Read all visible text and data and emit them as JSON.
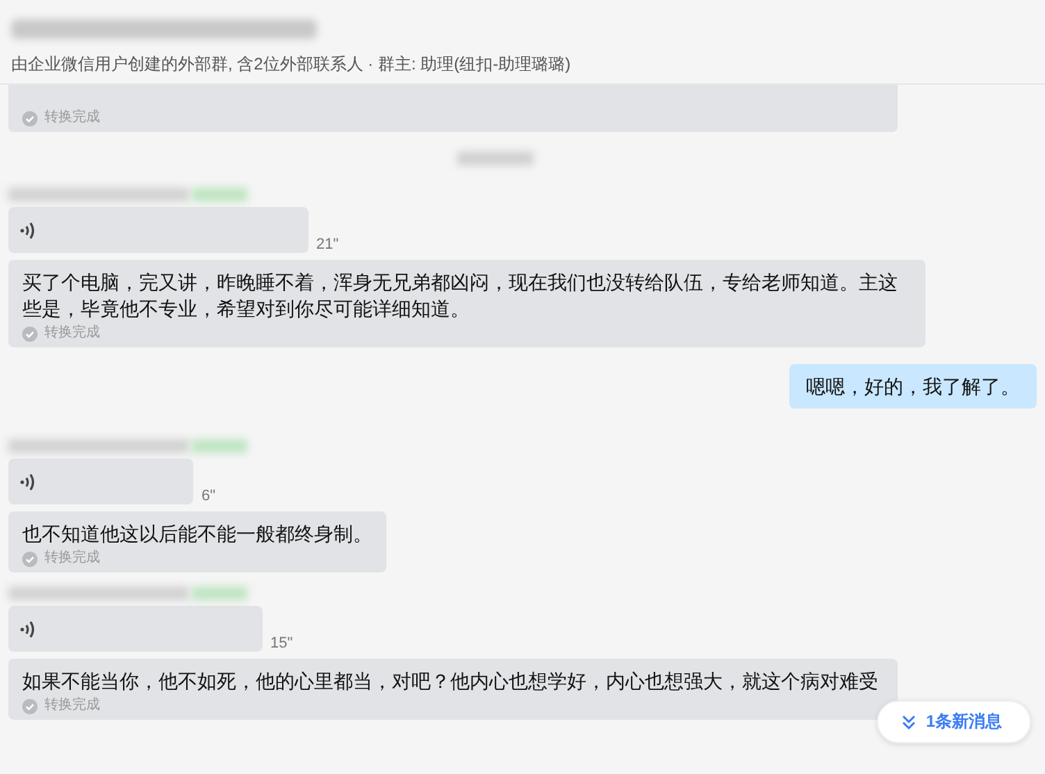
{
  "header": {
    "subtitle": "由企业微信用户创建的外部群, 含2位外部联系人 · 群主: 助理(纽扣-助理璐璐)"
  },
  "messages": [
    {
      "kind": "transcript",
      "status": "转换完成"
    },
    {
      "kind": "time"
    },
    {
      "kind": "sender"
    },
    {
      "kind": "voice",
      "duration": "21\""
    },
    {
      "kind": "transcript",
      "text": "买了个电脑，完又讲，昨晚睡不着，浑身无兄弟都凶闷，现在我们也没转给队伍，专给老师知道。主这些是，毕竟他不专业，希望对到你尽可能详细知道。",
      "status": "转换完成"
    },
    {
      "kind": "outgoing",
      "text": "嗯嗯，好的，我了解了。"
    },
    {
      "kind": "sender"
    },
    {
      "kind": "voice",
      "duration": "6\""
    },
    {
      "kind": "transcript",
      "text": "也不知道他这以后能不能一般都终身制。",
      "status": "转换完成"
    },
    {
      "kind": "sender"
    },
    {
      "kind": "voice",
      "duration": "15\""
    },
    {
      "kind": "transcript",
      "text": "如果不能当你，他不如死，他的心里都当，对吧？他内心也想学好，内心也想强大，就这个病对难受",
      "status": "转换完成"
    }
  ],
  "new_message_pill": {
    "label": "1条新消息"
  }
}
